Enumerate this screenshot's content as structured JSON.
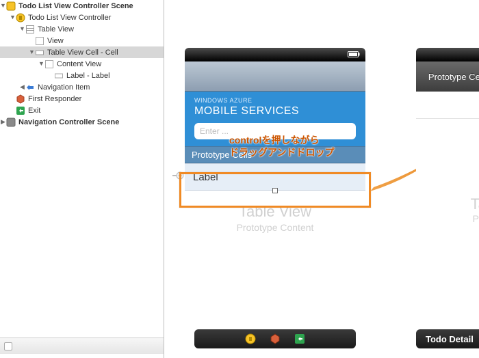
{
  "outline": {
    "scene_a": {
      "title": "Todo List View Controller Scene",
      "vc": "Todo List View Controller",
      "tableview": "Table View",
      "view": "View",
      "cell": "Table View Cell - Cell",
      "contentview": "Content View",
      "label": "Label - Label",
      "navitem": "Navigation Item",
      "firstresponder": "First Responder",
      "exit": "Exit"
    },
    "scene_b": {
      "title": "Navigation Controller Scene"
    }
  },
  "scene1": {
    "windows_azure": "WINDOWS AZURE",
    "mobile_services": "MOBILE SERVICES",
    "enter_placeholder": "Enter ...",
    "proto_header": "Prototype Cells",
    "cell_label": "Label",
    "tableview_title": "Table View",
    "tableview_sub": "Prototype Content"
  },
  "scene2": {
    "nav_title": "Prototype Cells",
    "tableview_title": "Tabl",
    "tableview_sub": "Protot",
    "dock_title": "Todo Detail"
  },
  "annotation": {
    "line1": "controlを押しながら",
    "line2": "ドラッグアンドドロップ"
  }
}
